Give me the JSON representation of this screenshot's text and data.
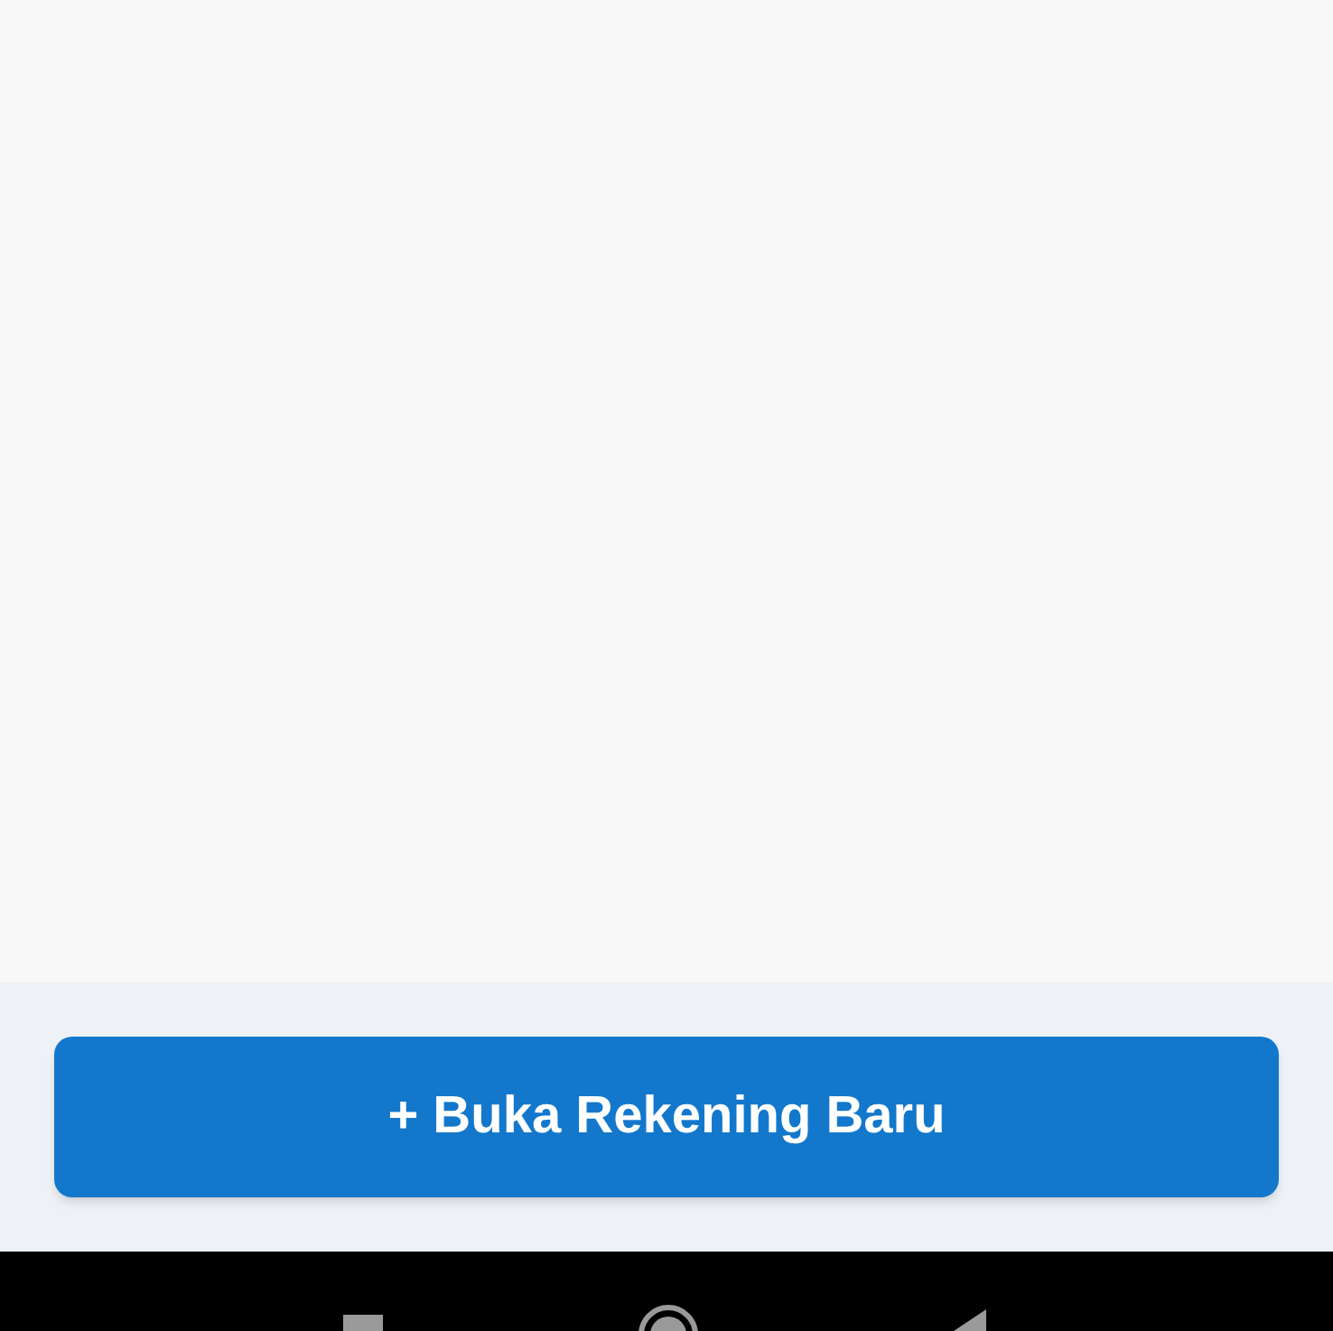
{
  "button": {
    "label": "+ Buka Rekening Baru"
  }
}
